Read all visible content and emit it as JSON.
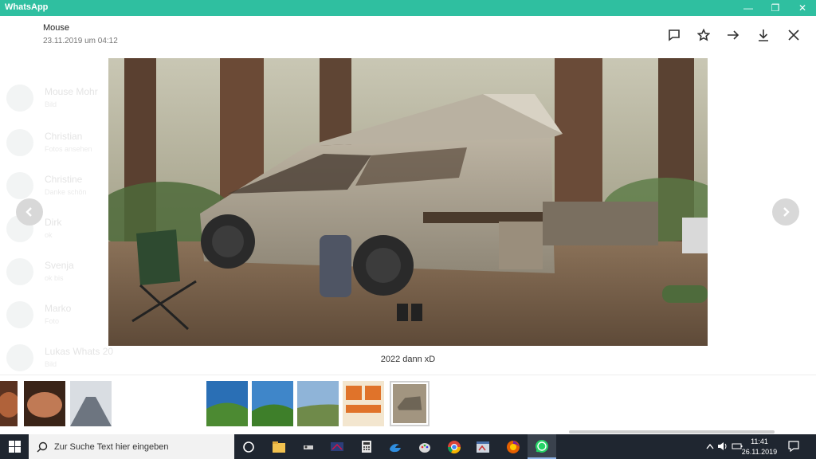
{
  "window": {
    "title": "WhatsApp",
    "controls": {
      "minimize": "—",
      "maximize": "❐",
      "close": "✕"
    }
  },
  "background_chats": [
    {
      "name": "Mouse Mohr",
      "snippet": "Bild"
    },
    {
      "name": "Christian",
      "snippet": "Fotos ansehen"
    },
    {
      "name": "Christine",
      "snippet": "Danke schön"
    },
    {
      "name": "Dirk",
      "snippet": "ok"
    },
    {
      "name": "Svenja",
      "snippet": "ok bis"
    },
    {
      "name": "Marko",
      "snippet": "Foto"
    },
    {
      "name": "Lukas Whats 20",
      "snippet": "Bild"
    }
  ],
  "viewer": {
    "sender": "Mouse",
    "timestamp": "23.11.2019 um 04:12",
    "caption": "2022 dann xD",
    "actions": [
      "reply-icon",
      "star-icon",
      "forward-icon",
      "download-icon",
      "close-icon"
    ]
  },
  "thumbnails": [
    {
      "kind": "food",
      "colors": [
        "#5a3220",
        "#b0623a"
      ]
    },
    {
      "kind": "food",
      "colors": [
        "#3a2418",
        "#c07a55"
      ]
    },
    {
      "kind": "plane-interior",
      "colors": [
        "#d9dde2",
        "#6d7580"
      ]
    },
    {
      "kind": "landscape",
      "colors": [
        "#2a6fb5",
        "#4c8a32"
      ]
    },
    {
      "kind": "landscape",
      "colors": [
        "#3f86c9",
        "#3e7f2a"
      ]
    },
    {
      "kind": "landscape",
      "colors": [
        "#8fb4d8",
        "#6f8a4a"
      ]
    },
    {
      "kind": "food-tray",
      "colors": [
        "#e0732a",
        "#f3e6cf"
      ]
    },
    {
      "kind": "truck",
      "colors": [
        "#a29580",
        "#6e6556"
      ],
      "selected": true
    }
  ],
  "taskbar": {
    "search_placeholder": "Zur Suche Text hier eingeben",
    "apps": [
      "cortana-icon",
      "file-explorer-icon",
      "app-icon",
      "screen-app-icon",
      "calculator-icon",
      "edge-icon",
      "paint-icon",
      "chrome-icon",
      "app-window-icon",
      "firefox-icon",
      "whatsapp-icon"
    ],
    "active_app": "whatsapp-icon",
    "time": "11:41",
    "date": "26.11.2019"
  },
  "colors": {
    "accent": "#2fbfa0",
    "taskbar": "#1f2630"
  }
}
